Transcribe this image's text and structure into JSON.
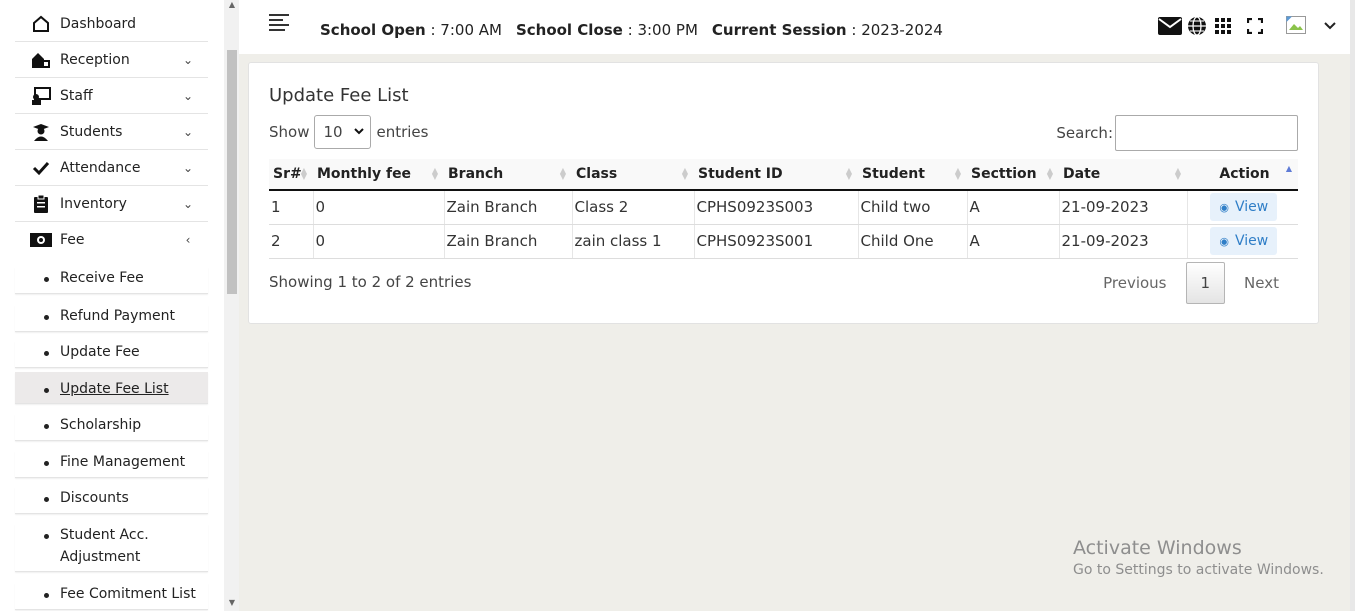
{
  "sidebar": {
    "items": [
      {
        "label": "Dashboard",
        "icon": "home-icon"
      },
      {
        "label": "Reception",
        "icon": "reception-icon"
      },
      {
        "label": "Staff",
        "icon": "staff-icon"
      },
      {
        "label": "Students",
        "icon": "student-icon"
      },
      {
        "label": "Attendance",
        "icon": "check-icon"
      },
      {
        "label": "Inventory",
        "icon": "clipboard-icon"
      },
      {
        "label": "Fee",
        "icon": "money-icon"
      }
    ],
    "fee_submenu": [
      {
        "label": "Receive Fee"
      },
      {
        "label": "Refund Payment"
      },
      {
        "label": "Update Fee"
      },
      {
        "label": "Update Fee List",
        "active": true
      },
      {
        "label": "Scholarship"
      },
      {
        "label": "Fine Management"
      },
      {
        "label": "Discounts"
      },
      {
        "label": "Student Acc. Adjustment"
      },
      {
        "label": "Fee Comitment List"
      }
    ]
  },
  "header": {
    "open_label": "School Open",
    "open_time": "7:00 AM",
    "close_label": "School Close",
    "close_time": "3:00 PM",
    "session_label": "Current Session",
    "session_value": "2023-2024",
    "icons": [
      "envelope-icon",
      "globe-icon",
      "grid-icon",
      "fullscreen-icon",
      "avatar",
      "chevron-down-icon"
    ]
  },
  "main": {
    "title": "Update Fee List",
    "show_label": "Show",
    "entries_value": "10",
    "entries_label": "entries",
    "search_label": "Search:",
    "search_value": "",
    "columns": [
      "Sr#",
      "Monthly fee",
      "Branch",
      "Class",
      "Student ID",
      "Student",
      "Secttion",
      "Date",
      "Action"
    ],
    "rows": [
      {
        "sr": "1",
        "fee": "0",
        "branch": "Zain Branch",
        "class": "Class 2",
        "student_id": "CPHS0923S003",
        "student": "Child two",
        "section": "A",
        "date": "21-09-2023",
        "action": "View"
      },
      {
        "sr": "2",
        "fee": "0",
        "branch": "Zain Branch",
        "class": "zain class 1",
        "student_id": "CPHS0923S001",
        "student": "Child One",
        "section": "A",
        "date": "21-09-2023",
        "action": "View"
      }
    ],
    "info": "Showing 1 to 2 of 2 entries",
    "pagination": {
      "previous": "Previous",
      "current": "1",
      "next": "Next"
    }
  },
  "watermark": {
    "title": "Activate Windows",
    "subtitle": "Go to Settings to activate Windows."
  },
  "colors": {
    "accent_link": "#2f7ec7",
    "page_bg": "#efeee9"
  }
}
